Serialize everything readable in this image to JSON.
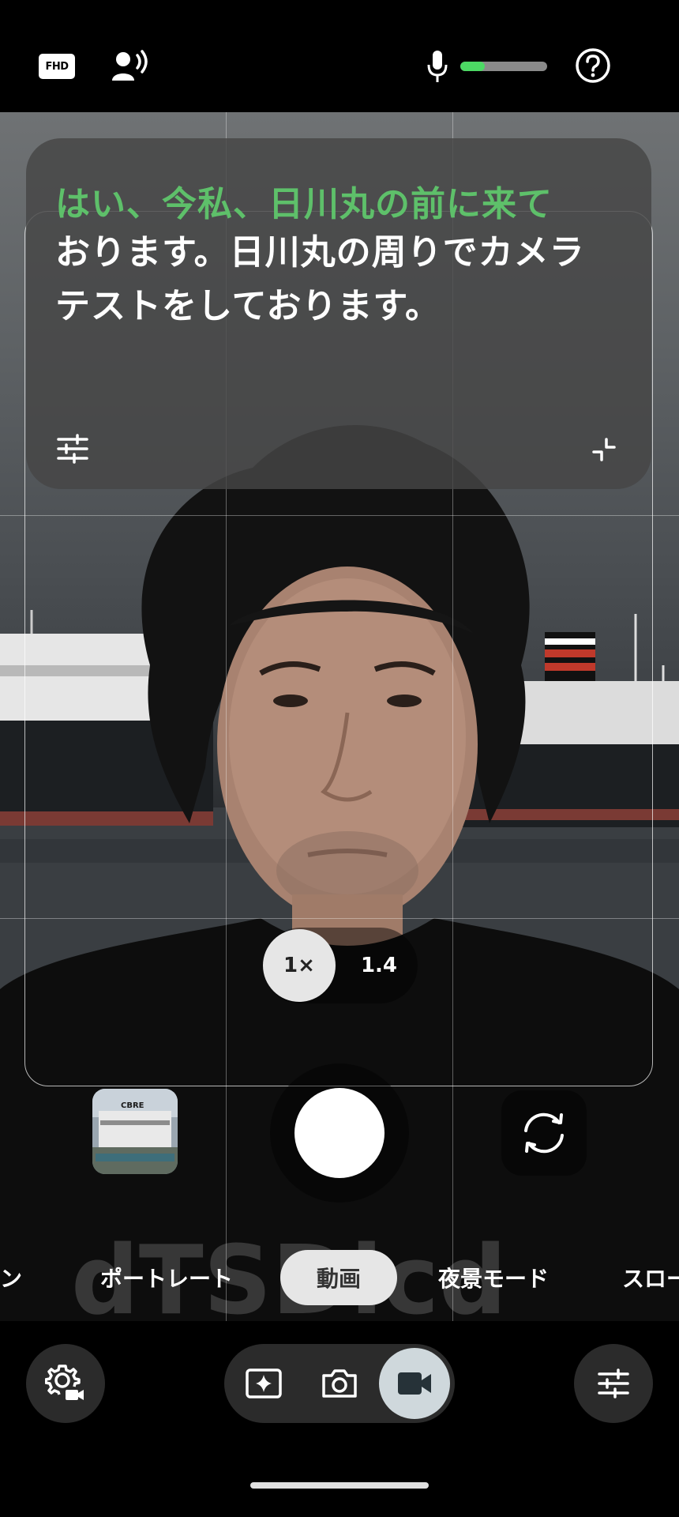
{
  "status": {
    "resolution_badge": "FHD",
    "mic_level": 0.28,
    "icons": [
      "speaker-voice-icon",
      "microphone-icon",
      "help-icon"
    ]
  },
  "caption": {
    "line_green": "はい、今私、日川丸の前に来て",
    "text_white": "おります。日川丸の周りでカメラテストをしております。"
  },
  "zoom": {
    "active": "1×",
    "alt": "1.4"
  },
  "modes": {
    "items": [
      "ン",
      "ポートレート",
      "動画",
      "夜景モード",
      "スロー"
    ],
    "active": "動画"
  },
  "thumbnail": {
    "sign_text": "CBRE"
  },
  "colors": {
    "caption_green": "#5ec06a",
    "level_green": "#4cd964",
    "active_chip": "#e6e6e6",
    "active_dock": "#cfd8dc"
  }
}
